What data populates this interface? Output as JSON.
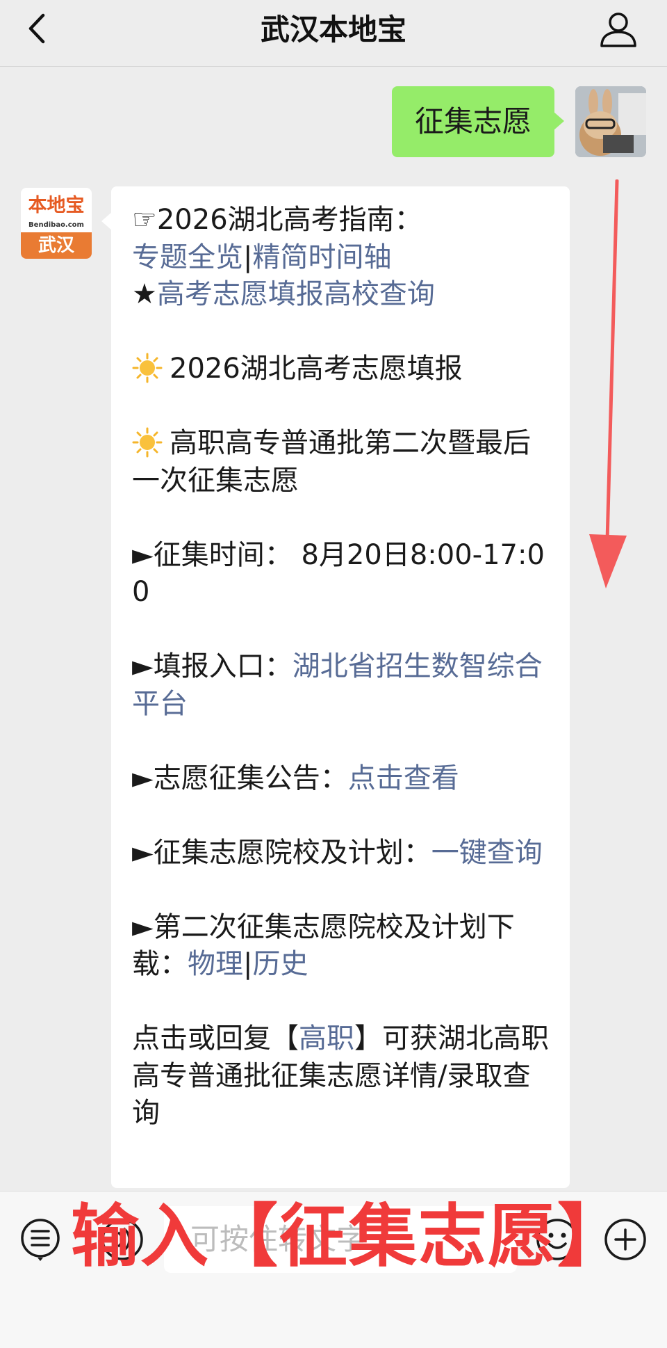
{
  "header": {
    "title": "武汉本地宝",
    "back_icon": "chevron-left-icon",
    "profile_icon": "person-icon"
  },
  "user_message": "征集志愿",
  "bot": {
    "logo_top": "本地宝",
    "logo_sub": "Bendibao.com",
    "logo_bottom": "武汉"
  },
  "reply": {
    "guide_prefix": "☞2026湖北高考指南：",
    "link_overview": "专题全览",
    "sep1": "|",
    "link_timeline": "精简时间轴",
    "star": "★",
    "link_query": "高考志愿填报高校查询",
    "fill_title": "2026湖北高考志愿填报",
    "batch_title": "高职高专普通批第二次暨最后一次征集志愿",
    "time_label": "►征集时间： 8月20日8:00-17:00",
    "entry_label": "►填报入口：",
    "entry_link": "湖北省招生数智综合平台",
    "notice_label": "►志愿征集公告：",
    "notice_link": "点击查看",
    "plan_label": "►征集志愿院校及计划：",
    "plan_link": "一键查询",
    "download_label": "►第二次征集志愿院校及计划下载：",
    "link_physics": "物理",
    "sep2": "|",
    "link_history": "历史",
    "tip_prefix": "点击或回复【",
    "tip_link": "高职",
    "tip_suffix": "】可获湖北高职高专普通批征集志愿详情/录取查询"
  },
  "input_bar": {
    "placeholder": "可按住转文字",
    "menu_icon": "menu-list-icon",
    "voice_icon": "voice-icon",
    "emoji_icon": "emoji-icon",
    "plus_icon": "plus-circle-icon"
  },
  "overlay_text": "输入【征集志愿】",
  "colors": {
    "link": "#576b95",
    "my_bubble": "#95ec69",
    "overlay": "#f03a3a",
    "arrow": "#f35b5b"
  }
}
